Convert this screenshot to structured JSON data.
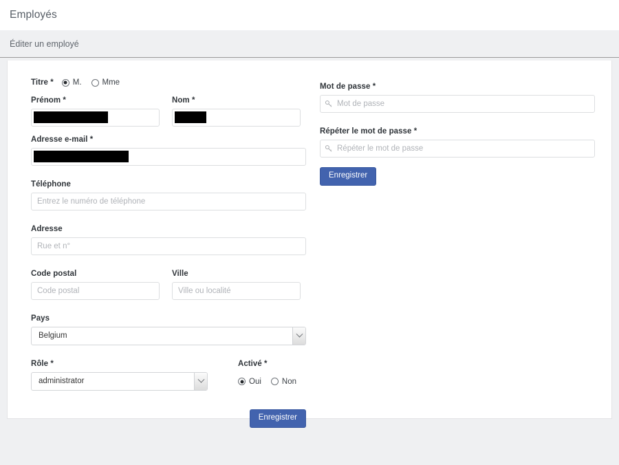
{
  "header": {
    "app_title": "Employés",
    "page_title": "Éditer un employé"
  },
  "form": {
    "title_field": {
      "label": "Titre *",
      "options": [
        {
          "label": "M.",
          "selected": true
        },
        {
          "label": "Mme",
          "selected": false
        }
      ]
    },
    "first_name": {
      "label": "Prénom *",
      "value": "",
      "redacted": true,
      "redaction_width": 108
    },
    "last_name": {
      "label": "Nom *",
      "value": "",
      "redacted": true,
      "redaction_width": 46
    },
    "email": {
      "label": "Adresse e-mail *",
      "value": "",
      "redacted": true,
      "redaction_width": 138
    },
    "phone": {
      "label": "Téléphone",
      "placeholder": "Entrez le numéro de téléphone",
      "value": ""
    },
    "address": {
      "label": "Adresse",
      "placeholder": "Rue et n°",
      "value": ""
    },
    "postal_code": {
      "label": "Code postal",
      "placeholder": "Code postal",
      "value": ""
    },
    "city": {
      "label": "Ville",
      "placeholder": "Ville ou localité",
      "value": ""
    },
    "country": {
      "label": "Pays",
      "value": "Belgium"
    },
    "role": {
      "label": "Rôle *",
      "value": "administrator"
    },
    "active": {
      "label": "Activé *",
      "options": [
        {
          "label": "Oui",
          "selected": true
        },
        {
          "label": "Non",
          "selected": false
        }
      ]
    },
    "password": {
      "label": "Mot de passe *",
      "placeholder": "Mot de passe",
      "value": "",
      "icon": "key-icon"
    },
    "password_repeat": {
      "label": "Répéter le mot de passe *",
      "placeholder": "Répéter le mot de passe",
      "value": "",
      "icon": "key-icon"
    },
    "save_top_label": "Enregistrer",
    "save_bottom_label": "Enregistrer"
  },
  "colors": {
    "primary_button": "#4263ae",
    "page_background": "#eff0f2",
    "card_background": "#ffffff",
    "label_text": "#2e3338",
    "placeholder_text": "#b0b3b8"
  }
}
